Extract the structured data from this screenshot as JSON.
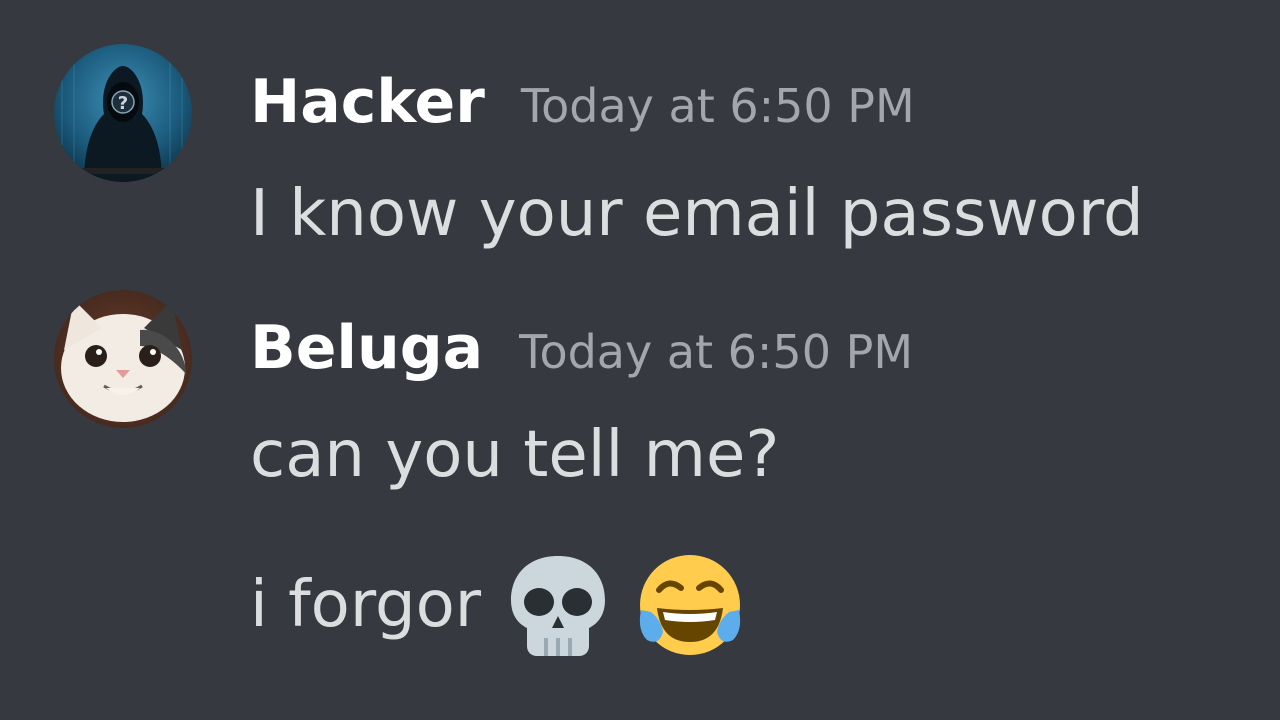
{
  "messages": [
    {
      "username": "Hacker",
      "timestamp": "Today at 6:50 PM",
      "avatar_icon": "hooded-hacker-avatar",
      "lines": [
        "I know your email password"
      ]
    },
    {
      "username": "Beluga",
      "timestamp": "Today at 6:50 PM",
      "avatar_icon": "beluga-cat-avatar",
      "lines": [
        "can you tell me?",
        "i forgor"
      ],
      "emojis": [
        "skull-emoji",
        "tears-of-joy-emoji"
      ]
    }
  ],
  "colors": {
    "background": "#36393f",
    "username": "#ffffff",
    "timestamp": "#a3a6aa",
    "message_text": "#dcddde"
  }
}
